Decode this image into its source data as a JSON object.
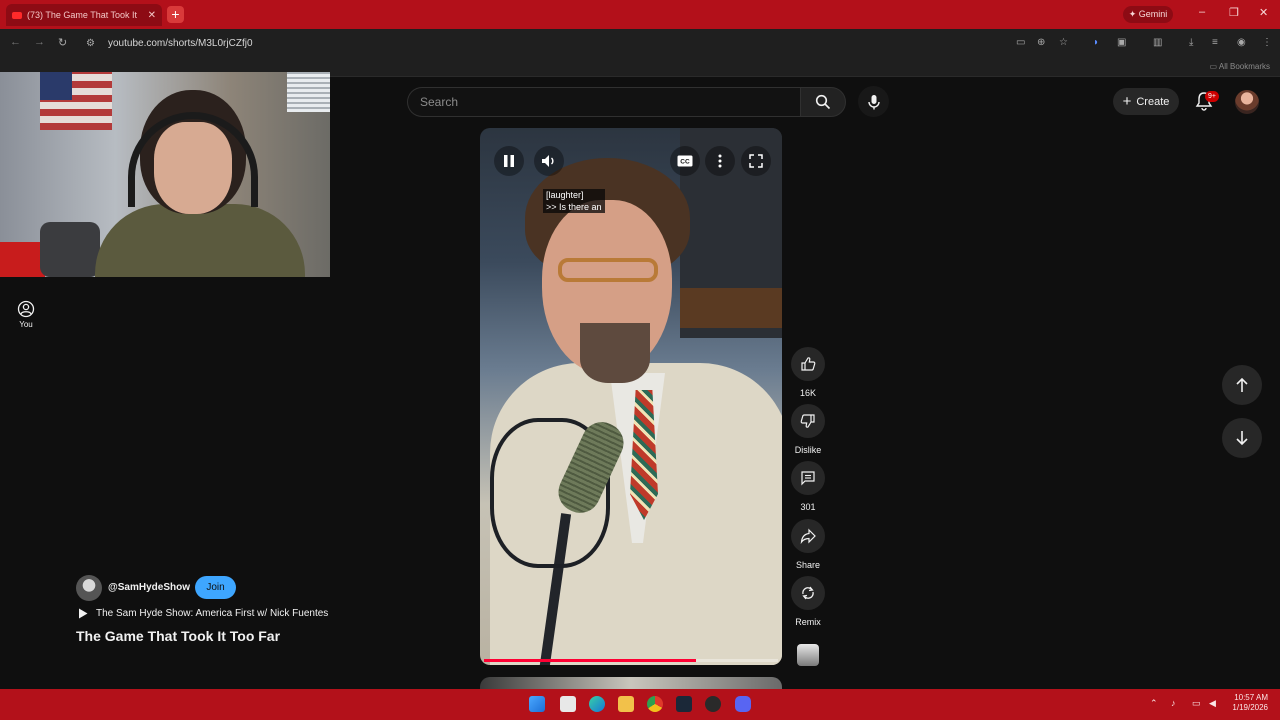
{
  "browser": {
    "tab_title": "(73) The Game That Took It",
    "tab_close": "✕",
    "new_tab": "+",
    "gemini_label": "Gemini",
    "url": "youtube.com/shorts/M3L0rjCZfj0",
    "all_bookmarks": "All Bookmarks",
    "window_controls": [
      "–",
      "❐",
      "✕"
    ]
  },
  "header": {
    "search_placeholder": "Search",
    "create_label": "Create",
    "notification_badge": "9+"
  },
  "sidebar": {
    "you_label": "You"
  },
  "player": {
    "caption_text": "[laughter]\n>> Is there an",
    "progress_fraction": 0.72
  },
  "actions": {
    "like_count": "16K",
    "dislike_label": "Dislike",
    "comment_count": "301",
    "share_label": "Share",
    "remix_label": "Remix"
  },
  "channel": {
    "handle": "@SamHydeShow",
    "join_label": "Join",
    "playlist": "The Sam Hyde Show: America First w/ Nick Fuentes",
    "title": "The Game That Took It Too Far"
  },
  "taskbar": {
    "time": "10:57 AM",
    "date": "1/19/2026"
  },
  "colors": {
    "accent_red": "#b3101a",
    "join_blue": "#3ea6ff",
    "progress_red": "#ff0033"
  }
}
